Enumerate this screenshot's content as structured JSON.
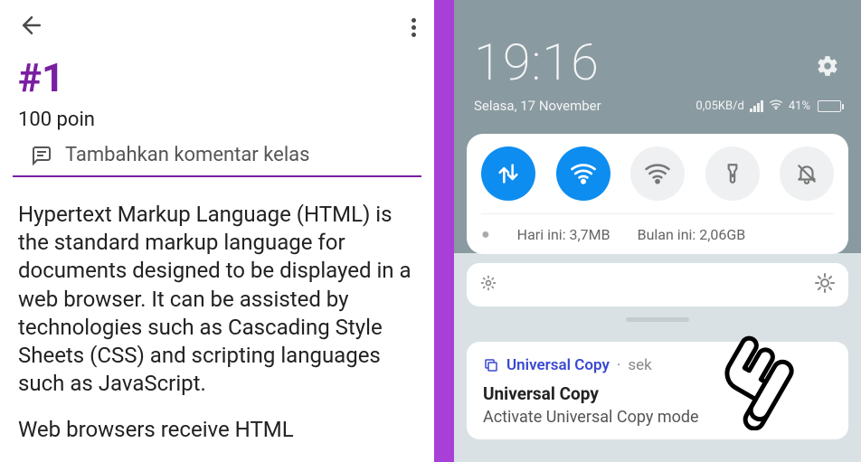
{
  "left": {
    "title": "#1",
    "points": "100 poin",
    "comment_placeholder": "Tambahkan komentar kelas",
    "body_p1": "Hypertext Markup Language (HTML) is the standard markup language for documents designed to be displayed in a web browser. It can be assisted by technologies such as Cascading Style Sheets (CSS) and scripting languages such as JavaScript.",
    "body_p2": "Web browsers receive HTML"
  },
  "right": {
    "clock": "19:16",
    "date": "Selasa, 17 November",
    "data_rate": "0,05KB/d",
    "battery_pct": "41%",
    "today_label": "Hari ini: 3,7MB",
    "month_label": "Bulan ini: 2,06GB",
    "notif": {
      "app": "Universal Copy",
      "time_sep": "·",
      "time": "sek",
      "title": "Universal Copy",
      "body": "Activate Universal Copy mode"
    }
  }
}
